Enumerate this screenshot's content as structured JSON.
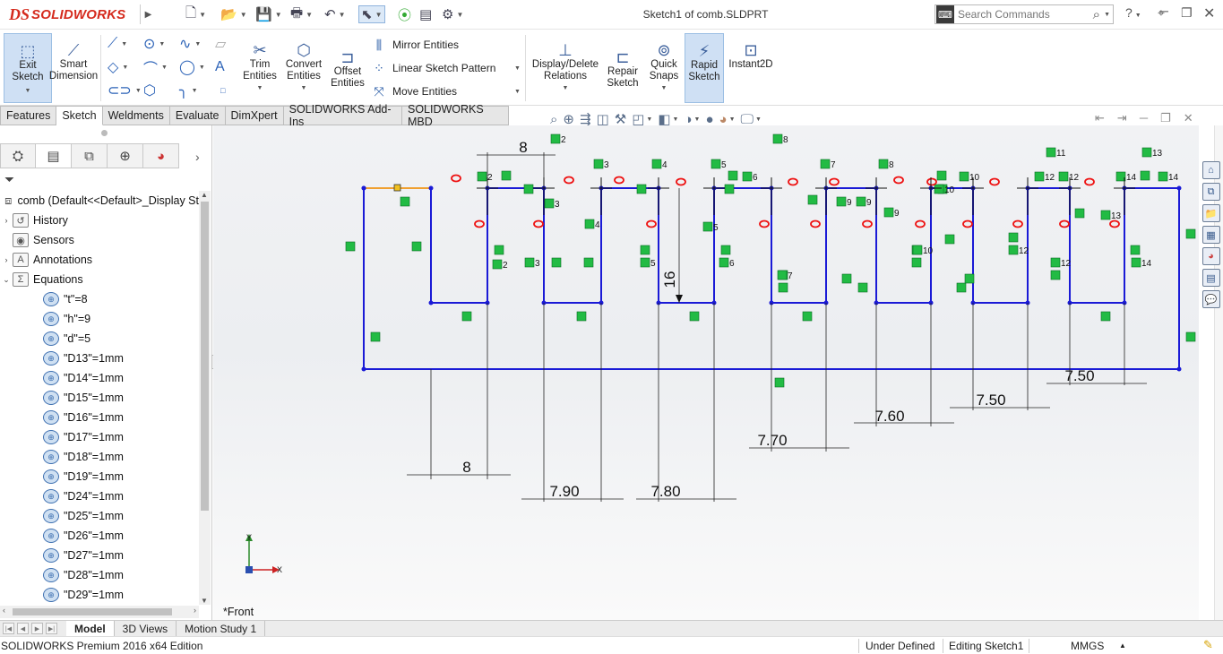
{
  "app": {
    "brand": "SOLIDWORKS",
    "logo_mark": "DS",
    "window_title": "Sketch1 of comb.SLDPRT"
  },
  "search": {
    "placeholder": "Search Commands"
  },
  "help": {
    "label": "?"
  },
  "ribbon": {
    "exit_sketch": "Exit Sketch",
    "smart_dimension": "Smart Dimension",
    "trim_entities": "Trim Entities",
    "convert_entities": "Convert Entities",
    "offset_entities": "Offset Entities",
    "mirror_entities": "Mirror Entities",
    "linear_sketch_pattern": "Linear Sketch Pattern",
    "move_entities": "Move Entities",
    "display_delete_relations": "Display/Delete Relations",
    "repair_sketch": "Repair Sketch",
    "quick_snaps": "Quick Snaps",
    "rapid_sketch": "Rapid Sketch",
    "instant2d": "Instant2D"
  },
  "command_tabs": [
    "Features",
    "Sketch",
    "Weldments",
    "Evaluate",
    "DimXpert",
    "SOLIDWORKS Add-Ins",
    "SOLIDWORKS MBD"
  ],
  "active_command_tab": "Sketch",
  "feature_tree": {
    "root": "comb  (Default<<Default>_Display St",
    "folders": [
      "History",
      "Sensors",
      "Annotations",
      "Equations"
    ],
    "equations": [
      "\"t\"=8",
      "\"h\"=9",
      "\"d\"=5",
      "\"D13\"=1mm",
      "\"D14\"=1mm",
      "\"D15\"=1mm",
      "\"D16\"=1mm",
      "\"D17\"=1mm",
      "\"D18\"=1mm",
      "\"D19\"=1mm",
      "\"D24\"=1mm",
      "\"D25\"=1mm",
      "\"D26\"=1mm",
      "\"D27\"=1mm",
      "\"D28\"=1mm",
      "\"D29\"=1mm"
    ]
  },
  "viewport": {
    "view_name": "*Front",
    "axis_x": "X",
    "axis_y": "Y",
    "dimensions": [
      "8",
      "8",
      "7.90",
      "7.80",
      "16",
      "7.70",
      "7.60",
      "7.50",
      "7.50"
    ],
    "relation_tags": [
      "2",
      "3",
      "4",
      "5",
      "6",
      "7",
      "8",
      "9",
      "10",
      "11",
      "12",
      "13",
      "14"
    ]
  },
  "bottom_tabs": [
    "Model",
    "3D Views",
    "Motion Study 1"
  ],
  "active_bottom_tab": "Model",
  "status": {
    "product": "SOLIDWORKS Premium 2016 x64 Edition",
    "sketch_state": "Under Defined",
    "editing": "Editing Sketch1",
    "units": "MMGS"
  },
  "colors": {
    "sketch_line": "#1a1ad6",
    "selected_line": "#f0a030",
    "relation_green": "#22bb44",
    "brand_red": "#d52b1e"
  }
}
